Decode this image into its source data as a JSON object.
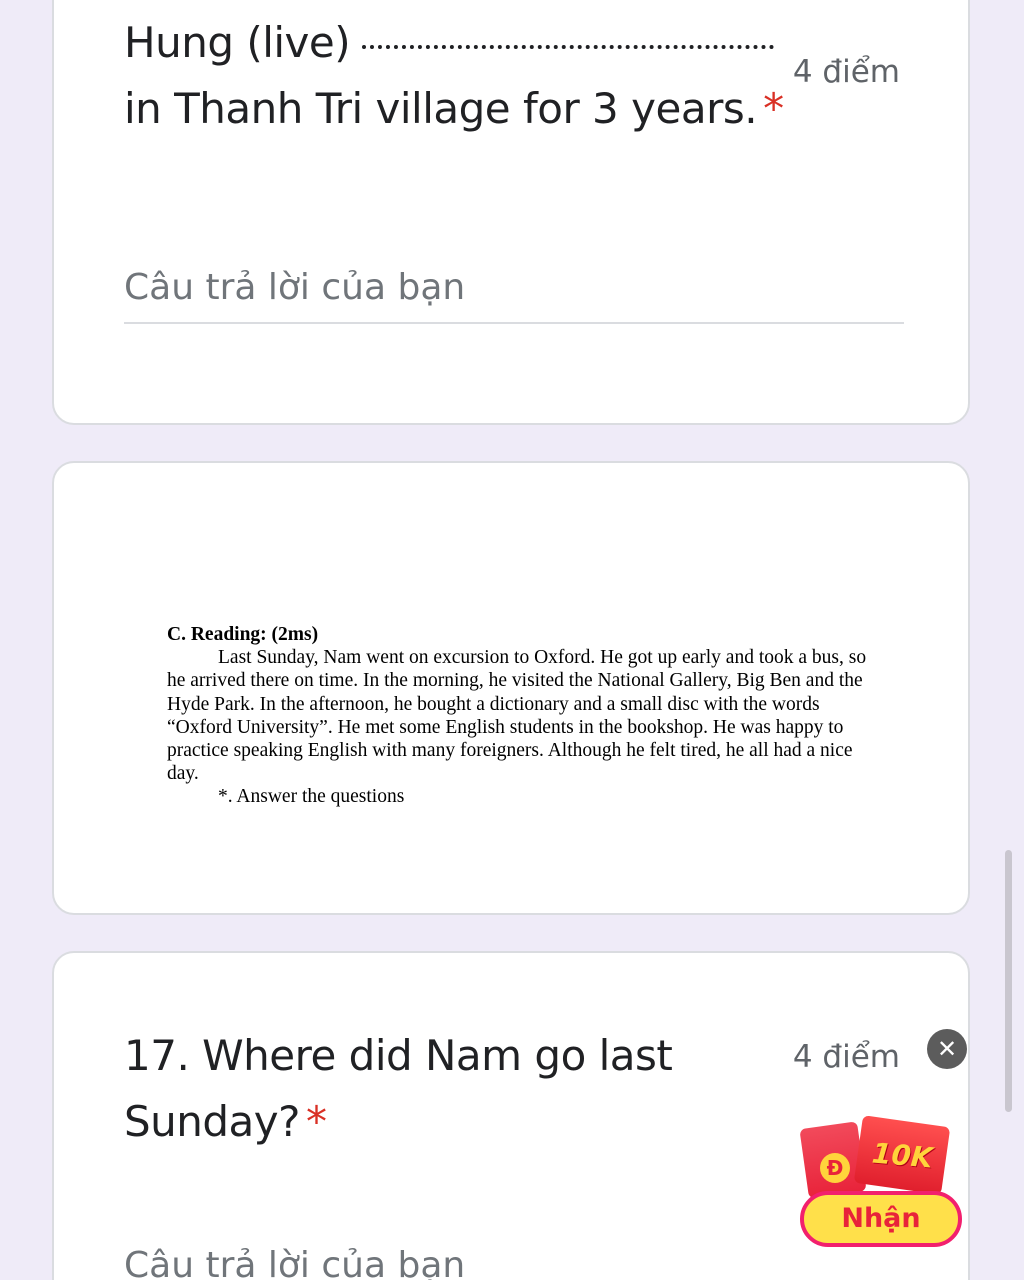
{
  "questions": [
    {
      "title_start": "Hung (live)",
      "title_end": "in Thanh Tri village for 3 years.",
      "required_mark": "*",
      "points": "4 điểm",
      "answer_placeholder": "Câu trả lời của bạn"
    },
    {
      "title": "17. Where did Nam go last Sunday?",
      "required_mark": "*",
      "points": "4 điểm",
      "answer_placeholder": "Câu trả lời của bạn"
    }
  ],
  "reading": {
    "heading": "C. Reading: (2ms)",
    "passage": "Last Sunday, Nam went on excursion to Oxford. He got up early and took a bus, so he arrived there on time. In the morning, he visited the National Gallery, Big Ben and the Hyde Park. In the afternoon, he bought a dictionary and a small disc with the words “Oxford University”. He met some English students in the bookshop. He was happy to practice speaking English with many foreigners. Although he felt tired, he all had a nice day.",
    "instruction": "*. Answer the questions"
  },
  "promo": {
    "currency_symbol": "Đ",
    "amount": "10K",
    "button_label": "Nhận",
    "close_symbol": "✕"
  }
}
